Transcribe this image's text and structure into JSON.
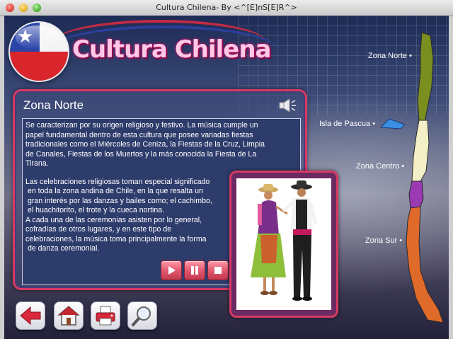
{
  "window": {
    "title": "Cultura Chilena- By <^[E]nS[E]R^>"
  },
  "header": {
    "app_title": "Cultura Chilena"
  },
  "panel": {
    "title": "Zona Norte",
    "paragraph1": [
      "Se caracterizan por su origen religioso y festivo. La música cumple un",
      "papel fundamental dentro de esta cultura que posee variadas fiestas",
      "tradicionales como el Miércoles de Ceniza, la Fiestas de la Cruz, Limpia",
      "de Canales, Fiestas de los Muertos y la más conocida la Fiesta de La",
      "Tirana."
    ],
    "paragraph2": [
      "Las celebraciones religiosas toman especial significado",
      " en toda la zona andina de Chile, en la que resalta un",
      " gran interés por las danzas y bailes como; el cachimbo,",
      " el huachitorito, el trote y la cueca nortina.",
      "A cada una de las ceremonias asisten por lo general,",
      "cofradías de otros lugares, y en este tipo de",
      "celebraciones, la música toma principalmente la forma",
      " de danza ceremonial."
    ]
  },
  "map": {
    "zones": [
      {
        "label": "Zona Norte •"
      },
      {
        "label": "Isla de Pascua •"
      },
      {
        "label": "Zona Centro •"
      },
      {
        "label": "Zona Sur •"
      }
    ],
    "colors": {
      "norte": "#7a8f1f",
      "centro": "#9b3ab3",
      "sur": "#e06a2a",
      "pascua": "#3a8fe0"
    }
  },
  "media_controls": [
    "play-icon",
    "pause-icon",
    "stop-icon"
  ],
  "nav_icons": [
    "back-arrow-icon",
    "home-icon",
    "printer-icon",
    "magnifier-icon"
  ],
  "theme": {
    "accent": "#d63a62",
    "panel_bg": "#2e3c6c"
  }
}
